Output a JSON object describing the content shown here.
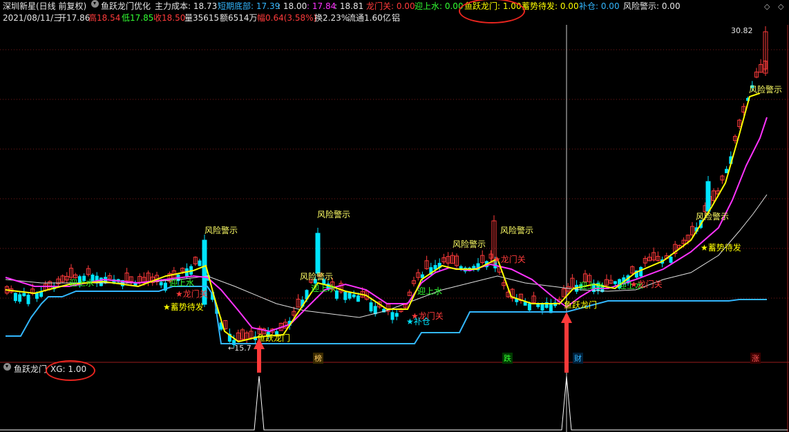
{
  "header": {
    "market_label": "深圳新星(日线 前复权)",
    "indicator_name": "鱼跃龙门优化",
    "cost_label": "主力成本: 18.73",
    "short_bottom_label": "短期底部: 17.39",
    "val_a": ": 18.00",
    "val_b": ": 17.84",
    "val_c": ": 18.81",
    "longmen_gate": "龙门关: 0.00",
    "welcome_water": "迎上水: 0.00",
    "fish_jump": "鱼跃龙门: 1.00",
    "ready": "蓄势待发: 0.00",
    "replenish": "补仓: 0.00",
    "risk": "风险警示: 0.00",
    "nav_left": "◇",
    "nav_right": "◇"
  },
  "quote": {
    "date": "2021/08/11/三",
    "open": "开17.86",
    "high": "高18.54",
    "low": "低17.85",
    "close": "收18.50",
    "volume": "量35615",
    "amount": "额6514万",
    "range": "幅0.64(3.58%)",
    "turnover": "换2.23%",
    "float": "流通1.60亿",
    "tag": "铝"
  },
  "price_labels": {
    "high_mark": "30.82",
    "low_mark": "←15.7"
  },
  "event_labels": {
    "bang": "榜",
    "die": "跌",
    "cai": "财",
    "zhang": "涨"
  },
  "signals": {
    "risk": "风险警示",
    "welcome": "迎上水",
    "gate": "★龙门关",
    "ready": "★蓄势待发",
    "replenish": "★补仓",
    "fish": "鱼跃龙门"
  },
  "lower_panel": {
    "name": "鱼跃龙门",
    "xg": "XG: 1.00"
  },
  "colors": {
    "up": "#ff3b3b",
    "down": "#00e5ff",
    "ma_yellow": "#ffff00",
    "ma_magenta": "#ff33ff",
    "ma_white": "#e0e0e0",
    "cost_line": "#33b7ff",
    "arrow": "#ff3a3a"
  }
}
